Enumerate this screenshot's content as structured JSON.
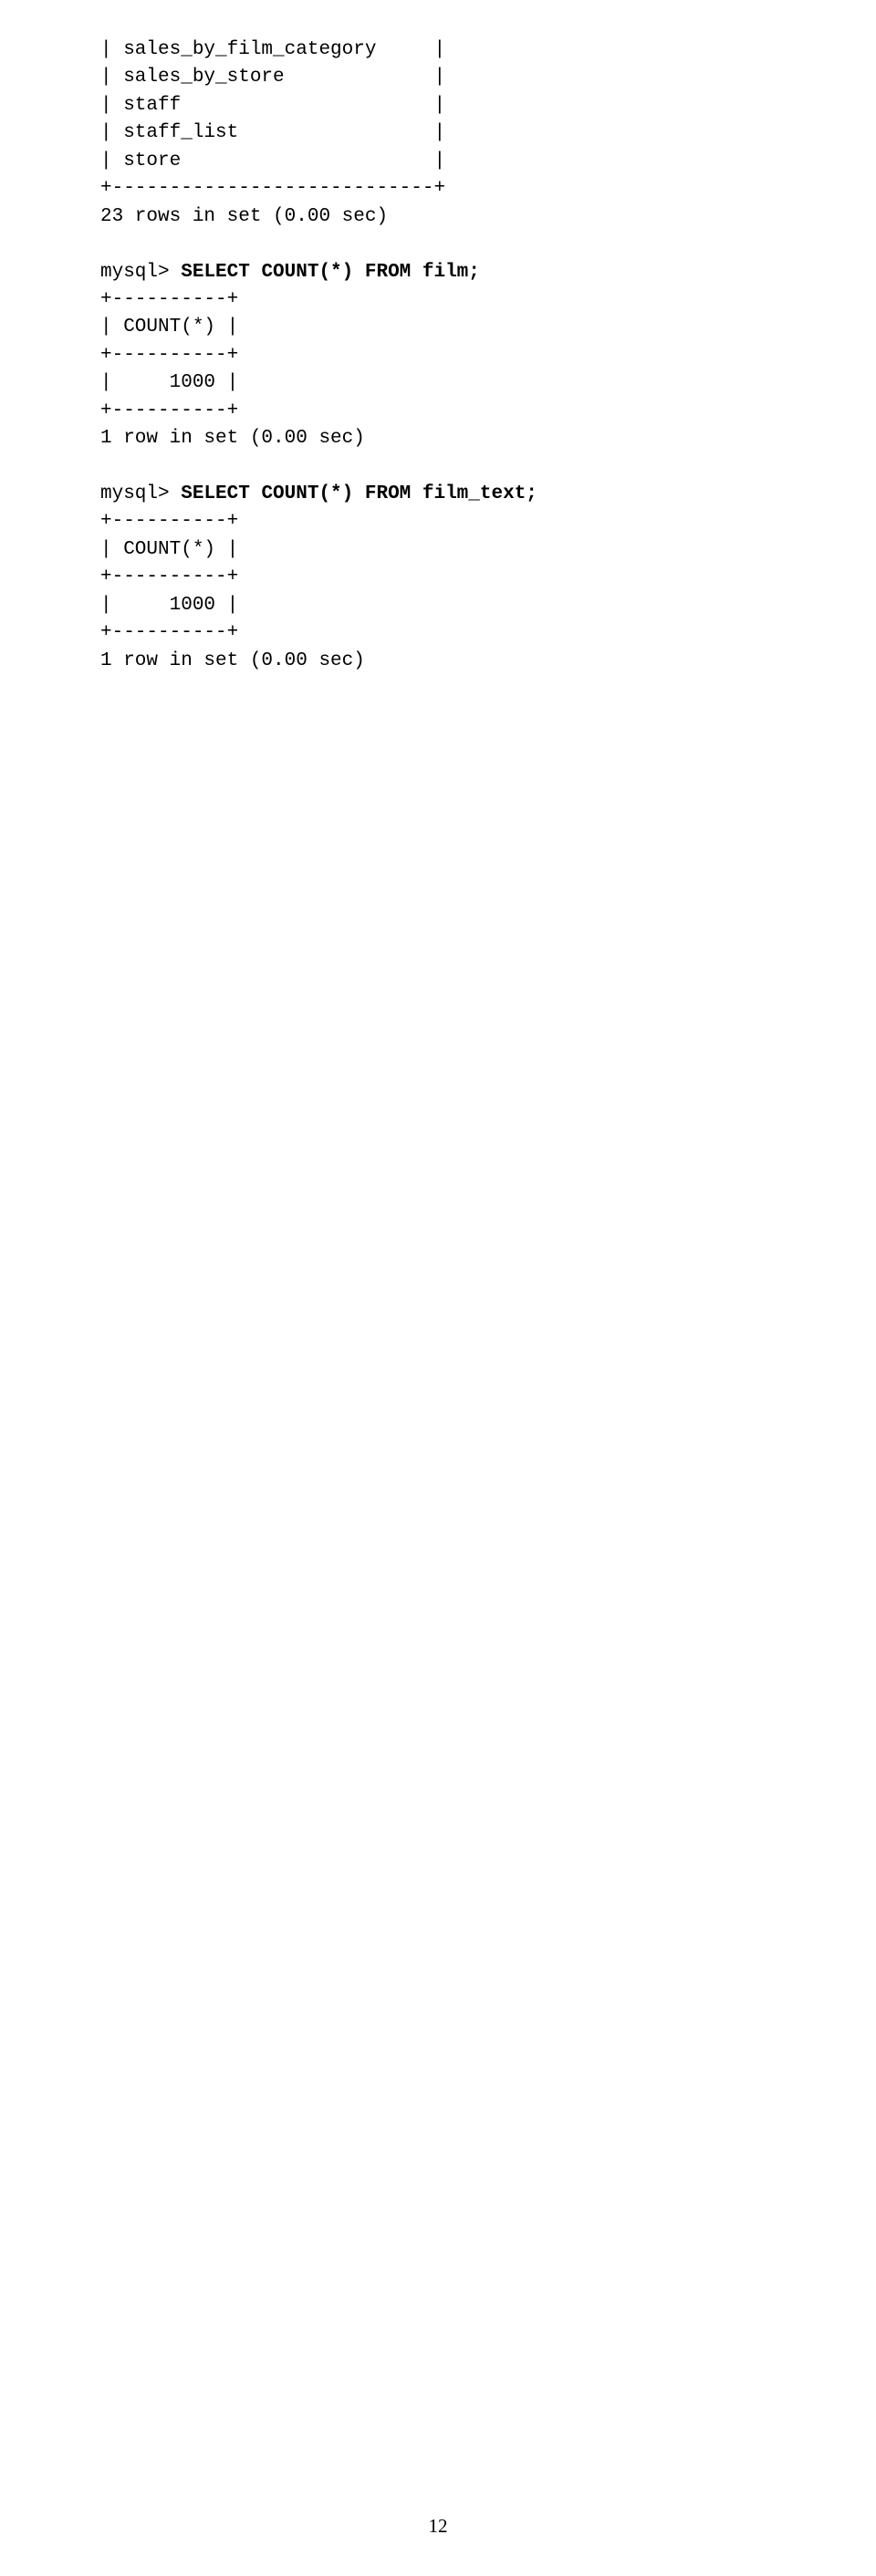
{
  "tables_tail": [
    "| sales_by_film_category     |",
    "| sales_by_store             |",
    "| staff                      |",
    "| staff_list                 |",
    "| store                      |",
    "+----------------------------+"
  ],
  "tables_summary": "23 rows in set (0.00 sec)",
  "prompt": "mysql>",
  "query1": "SELECT COUNT(*) FROM film;",
  "result1": {
    "border": "+----------+",
    "header": "| COUNT(*) |",
    "value": "|     1000 |",
    "summary": "1 row in set (0.00 sec)"
  },
  "query2": "SELECT COUNT(*) FROM film_text;",
  "result2": {
    "border": "+----------+",
    "header": "| COUNT(*) |",
    "value": "|     1000 |",
    "summary": "1 row in set (0.00 sec)"
  },
  "page_number": "12"
}
